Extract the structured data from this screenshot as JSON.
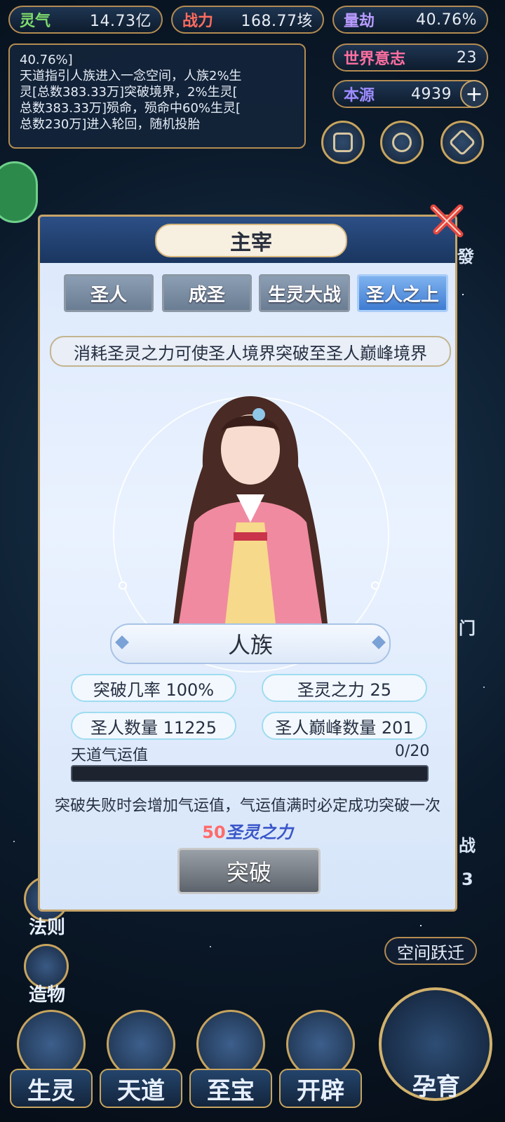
{
  "resources": {
    "lingqi": {
      "label": "灵气",
      "value": "14.73亿"
    },
    "zhanli": {
      "label": "战力",
      "value": "168.77垓"
    },
    "liangjie": {
      "label": "量劫",
      "value": "40.76%"
    },
    "shijie": {
      "label": "世界意志",
      "value": "23"
    },
    "benyuan": {
      "label": "本源",
      "value": "4939"
    }
  },
  "notice": {
    "lines": [
      "40.76%]",
      "天道指引人族进入一念空间，人族2%生",
      "灵[总数383.33万]突破境界，2%生灵[",
      "总数383.33万]殒命，殒命中60%生灵[",
      "总数230万]进入轮回，随机投胎"
    ]
  },
  "modal": {
    "title": "主宰",
    "tabs": [
      "圣人",
      "成圣",
      "生灵大战",
      "圣人之上"
    ],
    "active_tab": "圣人之上",
    "description": "消耗圣灵之力可使圣人境界突破至圣人巅峰境界",
    "race": "人族",
    "stats": {
      "break_rate": "突破几率 100%",
      "sacred_power": "圣灵之力 25",
      "saint_count": "圣人数量 11225",
      "peak_count": "圣人巅峰数量 201"
    },
    "luck": {
      "label": "天道气运值",
      "count": "0/20",
      "current": 0,
      "max": 20
    },
    "hint": "突破失败时会增加气运值，气运值满时必定成功突破一次",
    "cost": {
      "amount": "50",
      "resource": "圣灵之力"
    },
    "break_button": "突破"
  },
  "background": {
    "right_labels": {
      "fa": "發",
      "men": "门",
      "zhan": "战",
      "three": "3"
    },
    "space_jump": "空间跃迁",
    "left_labels": {
      "fa_ze": "法则",
      "zao_wu": "造物"
    }
  },
  "bottom_nav": {
    "items": [
      "生灵",
      "天道",
      "至宝",
      "开辟"
    ],
    "nurture": "孕育"
  },
  "colors": {
    "accent_gold": "#c7a45e",
    "active_tab": "#3e7cd2",
    "cost_red": "#ff6b6b"
  }
}
